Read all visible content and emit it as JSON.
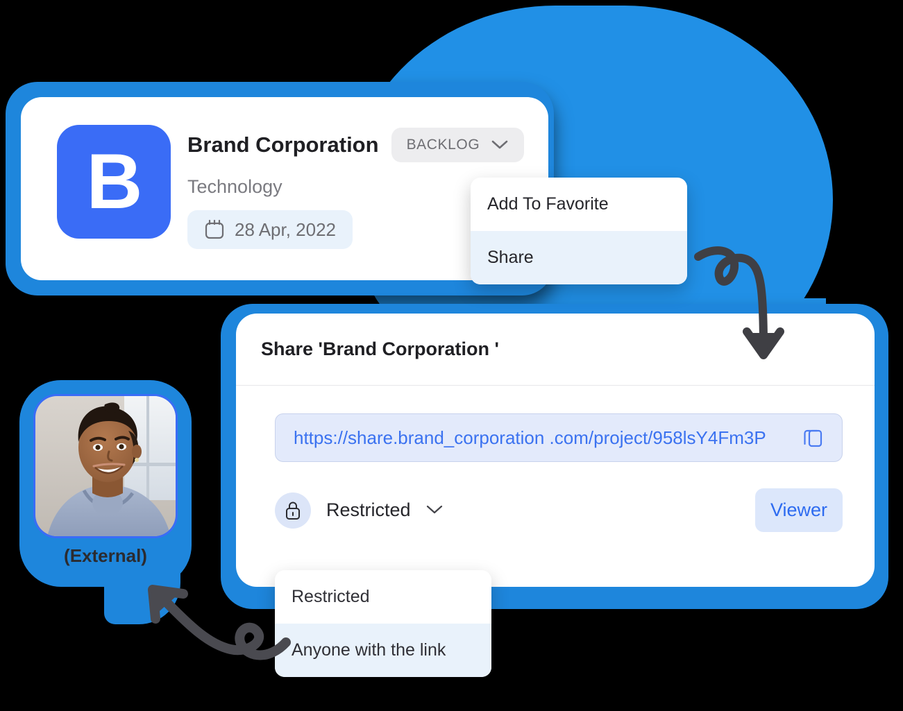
{
  "colors": {
    "bubble_blue": "#2190E6",
    "glow_blue": "#1E86DC",
    "logo_blue": "#3A6CF6",
    "link_blue": "#3B72F0",
    "viewer_blue": "#2D6BF0",
    "highlight_bg": "#E9F2FB"
  },
  "project_card": {
    "logo_letter": "B",
    "title": "Brand Corporation",
    "status_badge": "BACKLOG",
    "status_chevron_icon": "chevron-down-icon",
    "category": "Technology",
    "date": "28 Apr, 2022",
    "date_icon": "calendar-icon"
  },
  "context_menu": {
    "items": [
      {
        "label": "Add To Favorite",
        "selected": false
      },
      {
        "label": "Share",
        "selected": true
      }
    ]
  },
  "share_dialog": {
    "title": "Share 'Brand Corporation '",
    "url": "https://share.brand_corporation .com/project/958lsY4Fm3P",
    "copy_icon": "copy-icon",
    "permission": {
      "lock_icon": "lock-icon",
      "label": "Restricted",
      "chevron_icon": "chevron-down-icon"
    },
    "role_button": "Viewer"
  },
  "permission_menu": {
    "items": [
      {
        "label": "Restricted",
        "selected": false
      },
      {
        "label": "Anyone with the link",
        "selected": true
      }
    ]
  },
  "external_user": {
    "label": "(External)",
    "avatar_alt": "smiling-woman-photo"
  },
  "annotations": {
    "arrow_to_share_dialog": "curly-arrow-down-icon",
    "arrow_to_avatar": "squiggly-arrow-left-icon"
  }
}
